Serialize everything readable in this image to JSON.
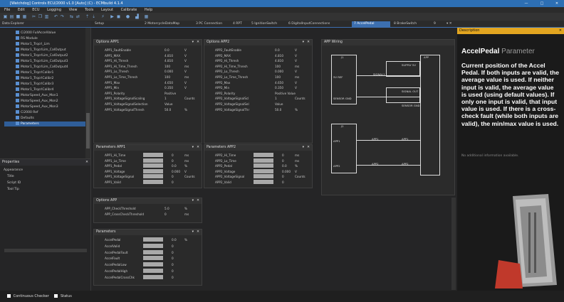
{
  "window": {
    "title": "[Watchdog] Controls ECU/2000 v1.0 [Auto] (C) - ECMbuild 4.1.4",
    "min_glyph": "—",
    "max_glyph": "□",
    "close_glyph": "✕"
  },
  "menu": [
    "File",
    "Edit",
    "ECU",
    "Logging",
    "View",
    "Tools",
    "Layout",
    "Calibrate",
    "Help"
  ],
  "toolbar_icons": [
    "new-icon",
    "open-icon",
    "save-icon",
    "save-all-icon",
    "cut-icon",
    "copy-icon",
    "paste-icon",
    "undo-icon",
    "redo-icon",
    "connect-icon",
    "disconnect-icon",
    "upload-icon",
    "download-icon",
    "flash-icon",
    "run-icon",
    "stop-icon",
    "record-icon",
    "chart-icon",
    "grid-icon"
  ],
  "tabs": [
    {
      "label": "Setup"
    },
    {
      "label": "2 MotorcycleDataMap"
    },
    {
      "label": "3 PC Connection"
    },
    {
      "label": "4 RPT"
    },
    {
      "label": "5 IgnitionSwitch"
    },
    {
      "label": "6 DigitalInputConnections"
    },
    {
      "label": "7 AccelPedal"
    },
    {
      "label": "8 BrakeSwitch"
    },
    {
      "label": "9"
    }
  ],
  "explorer": {
    "title": "Data Explorer",
    "items": [
      "Ci2000 FullAccelValue",
      "RS Module",
      "Motor1_Trqcrl_Lim",
      "Motor1_TrqcrlLim_CalOutput",
      "Motor1_TrqcrlLim_CalOutput2",
      "Motor1_TrqcrlLim_CalOutput3",
      "Motor1_TrqcrlLim_CalOutput4",
      "Motor1_TrqcrlCalibr1",
      "Motor1_TrqcrlCalibr2",
      "Motor1_TrqcrlCalibr3",
      "Motor1_TrqcrlCalibr4",
      "MotorSpeed_Aux_Mon1",
      "MotorSpeed_Aux_Mon2",
      "MotorSpeed_Aux_Mon3",
      "Ci2000 Ref",
      "Defaults",
      "Parameters"
    ],
    "selected": "Parameters"
  },
  "properties": {
    "title": "Properties",
    "rows": [
      "Appearance",
      "Title",
      "Script ID",
      "Tool Tip"
    ]
  },
  "status": {
    "check1": "Continuous Checker",
    "check2": "Status"
  },
  "options_app1": {
    "title": "Options APP1",
    "rows": [
      {
        "name": "APP1_FaultEnable",
        "value": "0.0",
        "unit": "V"
      },
      {
        "name": "APP1_MAX",
        "value": "4.810",
        "unit": "V"
      },
      {
        "name": "APP1_Hi_Thresh",
        "value": "4.810",
        "unit": "V"
      },
      {
        "name": "APP1_Hi_Time_Thresh",
        "value": "100",
        "unit": "ms"
      },
      {
        "name": "APP1_Lo_Thresh",
        "value": "0.000",
        "unit": "V"
      },
      {
        "name": "APP1_Lo_Time_Thresh",
        "value": "100",
        "unit": "ms"
      },
      {
        "name": "APP1_Max",
        "value": "4.650",
        "unit": "V"
      },
      {
        "name": "APP1_Min",
        "value": "0.350",
        "unit": "V"
      },
      {
        "name": "APP1_Polarity",
        "value": "Positive",
        "unit": ""
      },
      {
        "name": "APP1_VoltageSignalScaling",
        "value": "1",
        "unit": "Counts"
      },
      {
        "name": "APP1_VoltageSignalSelection",
        "value": "Value",
        "unit": ""
      },
      {
        "name": "APP1_VoltageSignalThresh",
        "value": "50.0",
        "unit": "%"
      }
    ]
  },
  "options_app2": {
    "title": "Options APP2",
    "rows": [
      {
        "name": "APP2_FaultEnable",
        "value": "0.0",
        "unit": "V"
      },
      {
        "name": "APP2_MAX",
        "value": "4.810",
        "unit": "V"
      },
      {
        "name": "APP2_Hi_Thresh",
        "value": "4.810",
        "unit": "V"
      },
      {
        "name": "APP2_Hi_Time_Thresh",
        "value": "100",
        "unit": "ms"
      },
      {
        "name": "APP2_Lo_Thresh",
        "value": "0.000",
        "unit": "V"
      },
      {
        "name": "APP2_Lo_Time_Thresh",
        "value": "100",
        "unit": "ms"
      },
      {
        "name": "APP2_Max",
        "value": "4.650",
        "unit": "V"
      },
      {
        "name": "APP2_Min",
        "value": "0.350",
        "unit": "V"
      },
      {
        "name": "APP2_Polarity",
        "value": "Positive Value",
        "unit": ""
      },
      {
        "name": "APP2_VoltageSignalScl",
        "value": "1",
        "unit": "Counts"
      },
      {
        "name": "APP2_VoltageSignalSel",
        "value": "Value",
        "unit": ""
      },
      {
        "name": "APP2_VoltageSignalThr",
        "value": "50.0",
        "unit": "%"
      }
    ]
  },
  "params_app1": {
    "title": "Parameters APP1",
    "rows": [
      {
        "name": "APP1_Hi_Time",
        "value": "0",
        "unit": "ms"
      },
      {
        "name": "APP1_Lo_Time",
        "value": "0",
        "unit": "ms"
      },
      {
        "name": "APP1_Pedal",
        "value": "0.0",
        "unit": "%"
      },
      {
        "name": "APP1_Voltage",
        "value": "0.000",
        "unit": "V"
      },
      {
        "name": "APP1_VoltageSignal",
        "value": "0",
        "unit": "Counts"
      },
      {
        "name": "APP1_Valid",
        "value": "0",
        "unit": ""
      }
    ]
  },
  "params_app2": {
    "title": "Parameters APP2",
    "rows": [
      {
        "name": "APP2_Hi_Time",
        "value": "0",
        "unit": "ms"
      },
      {
        "name": "APP2_Lo_Time",
        "value": "0",
        "unit": "ms"
      },
      {
        "name": "APP2_Pedal",
        "value": "0.0",
        "unit": "%"
      },
      {
        "name": "APP2_Voltage",
        "value": "0.000",
        "unit": "V"
      },
      {
        "name": "APP2_VoltageSignal",
        "value": "0",
        "unit": "Counts"
      },
      {
        "name": "APP2_Valid",
        "value": "0",
        "unit": ""
      }
    ]
  },
  "options_app": {
    "title": "Options APP",
    "rows": [
      {
        "name": "APP_CheckThreshold",
        "value": "5.0",
        "unit": "%"
      },
      {
        "name": "APP_CrossCheckThreshold",
        "value": "0",
        "unit": "ms"
      }
    ]
  },
  "parameters": {
    "title": "Parameters",
    "rows": [
      {
        "name": "AccelPedal",
        "value": "0.0",
        "unit": "%"
      },
      {
        "name": "AccelValid",
        "value": "0",
        "unit": ""
      },
      {
        "name": "AccelPedalFault",
        "value": "0",
        "unit": ""
      },
      {
        "name": "AccelFault",
        "value": "0",
        "unit": ""
      },
      {
        "name": "AccelPedalLow",
        "value": "0",
        "unit": ""
      },
      {
        "name": "AccelPedalHigh",
        "value": "0",
        "unit": ""
      },
      {
        "name": "AccelPedalCrossChk",
        "value": "0",
        "unit": ""
      }
    ]
  },
  "wiring": {
    "title": "APP Wiring",
    "ecu_label": "J1",
    "ecu_label2": "J2",
    "app_label": "APP",
    "pins_top": [
      "5V REF",
      "SIGNAL1",
      "SENSOR GND"
    ],
    "pins_bottom": [
      "APP1",
      "APP2"
    ],
    "right_pins": [
      "SUPPLY 5V",
      "SIGNAL OUT",
      "SENSOR GND"
    ],
    "right_pins2": [
      "APP1",
      "APP2"
    ]
  },
  "description": {
    "header": "Description",
    "title": "AccelPedal",
    "title_suffix": "Parameter",
    "body": "Current position of the Accel Pedal. If both inputs are valid, the average value is used. If neither input is valid, the average value is used (using default values). If only one input is valid, that input value is used. If there is a cross-check fault (while both inputs are valid), the min/max value is used.",
    "note": "No additional information available."
  }
}
